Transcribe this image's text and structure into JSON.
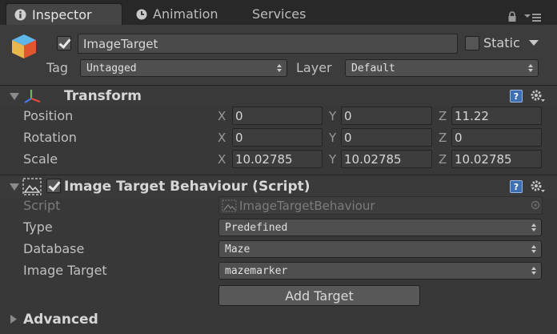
{
  "tabs": [
    {
      "label": "Inspector",
      "icon": "info-icon",
      "active": true
    },
    {
      "label": "Animation",
      "icon": "animation-clock-icon",
      "active": false
    },
    {
      "label": "Services",
      "icon": "",
      "active": false
    }
  ],
  "object": {
    "name": "ImageTarget",
    "active_checked": true,
    "static_label": "Static",
    "static_checked": false,
    "tag_label": "Tag",
    "tag_value": "Untagged",
    "layer_label": "Layer",
    "layer_value": "Default"
  },
  "transform": {
    "title": "Transform",
    "position_label": "Position",
    "rotation_label": "Rotation",
    "scale_label": "Scale",
    "axis_x": "X",
    "axis_y": "Y",
    "axis_z": "Z",
    "position": {
      "x": "0",
      "y": "0",
      "z": "11.22"
    },
    "rotation": {
      "x": "0",
      "y": "0",
      "z": "0"
    },
    "scale": {
      "x": "10.02785",
      "y": "10.02785",
      "z": "10.02785"
    }
  },
  "image_target_behaviour": {
    "title": "Image Target Behaviour (Script)",
    "enabled": true,
    "script_label": "Script",
    "script_value": "ImageTargetBehaviour",
    "type_label": "Type",
    "type_value": "Predefined",
    "database_label": "Database",
    "database_value": "Maze",
    "image_target_label": "Image Target",
    "image_target_value": "mazemarker",
    "add_target_label": "Add Target"
  },
  "advanced": {
    "label": "Advanced"
  },
  "colors": {
    "background": "#383838",
    "tab_bar": "#282828",
    "help_icon": "#3d6fb4"
  }
}
